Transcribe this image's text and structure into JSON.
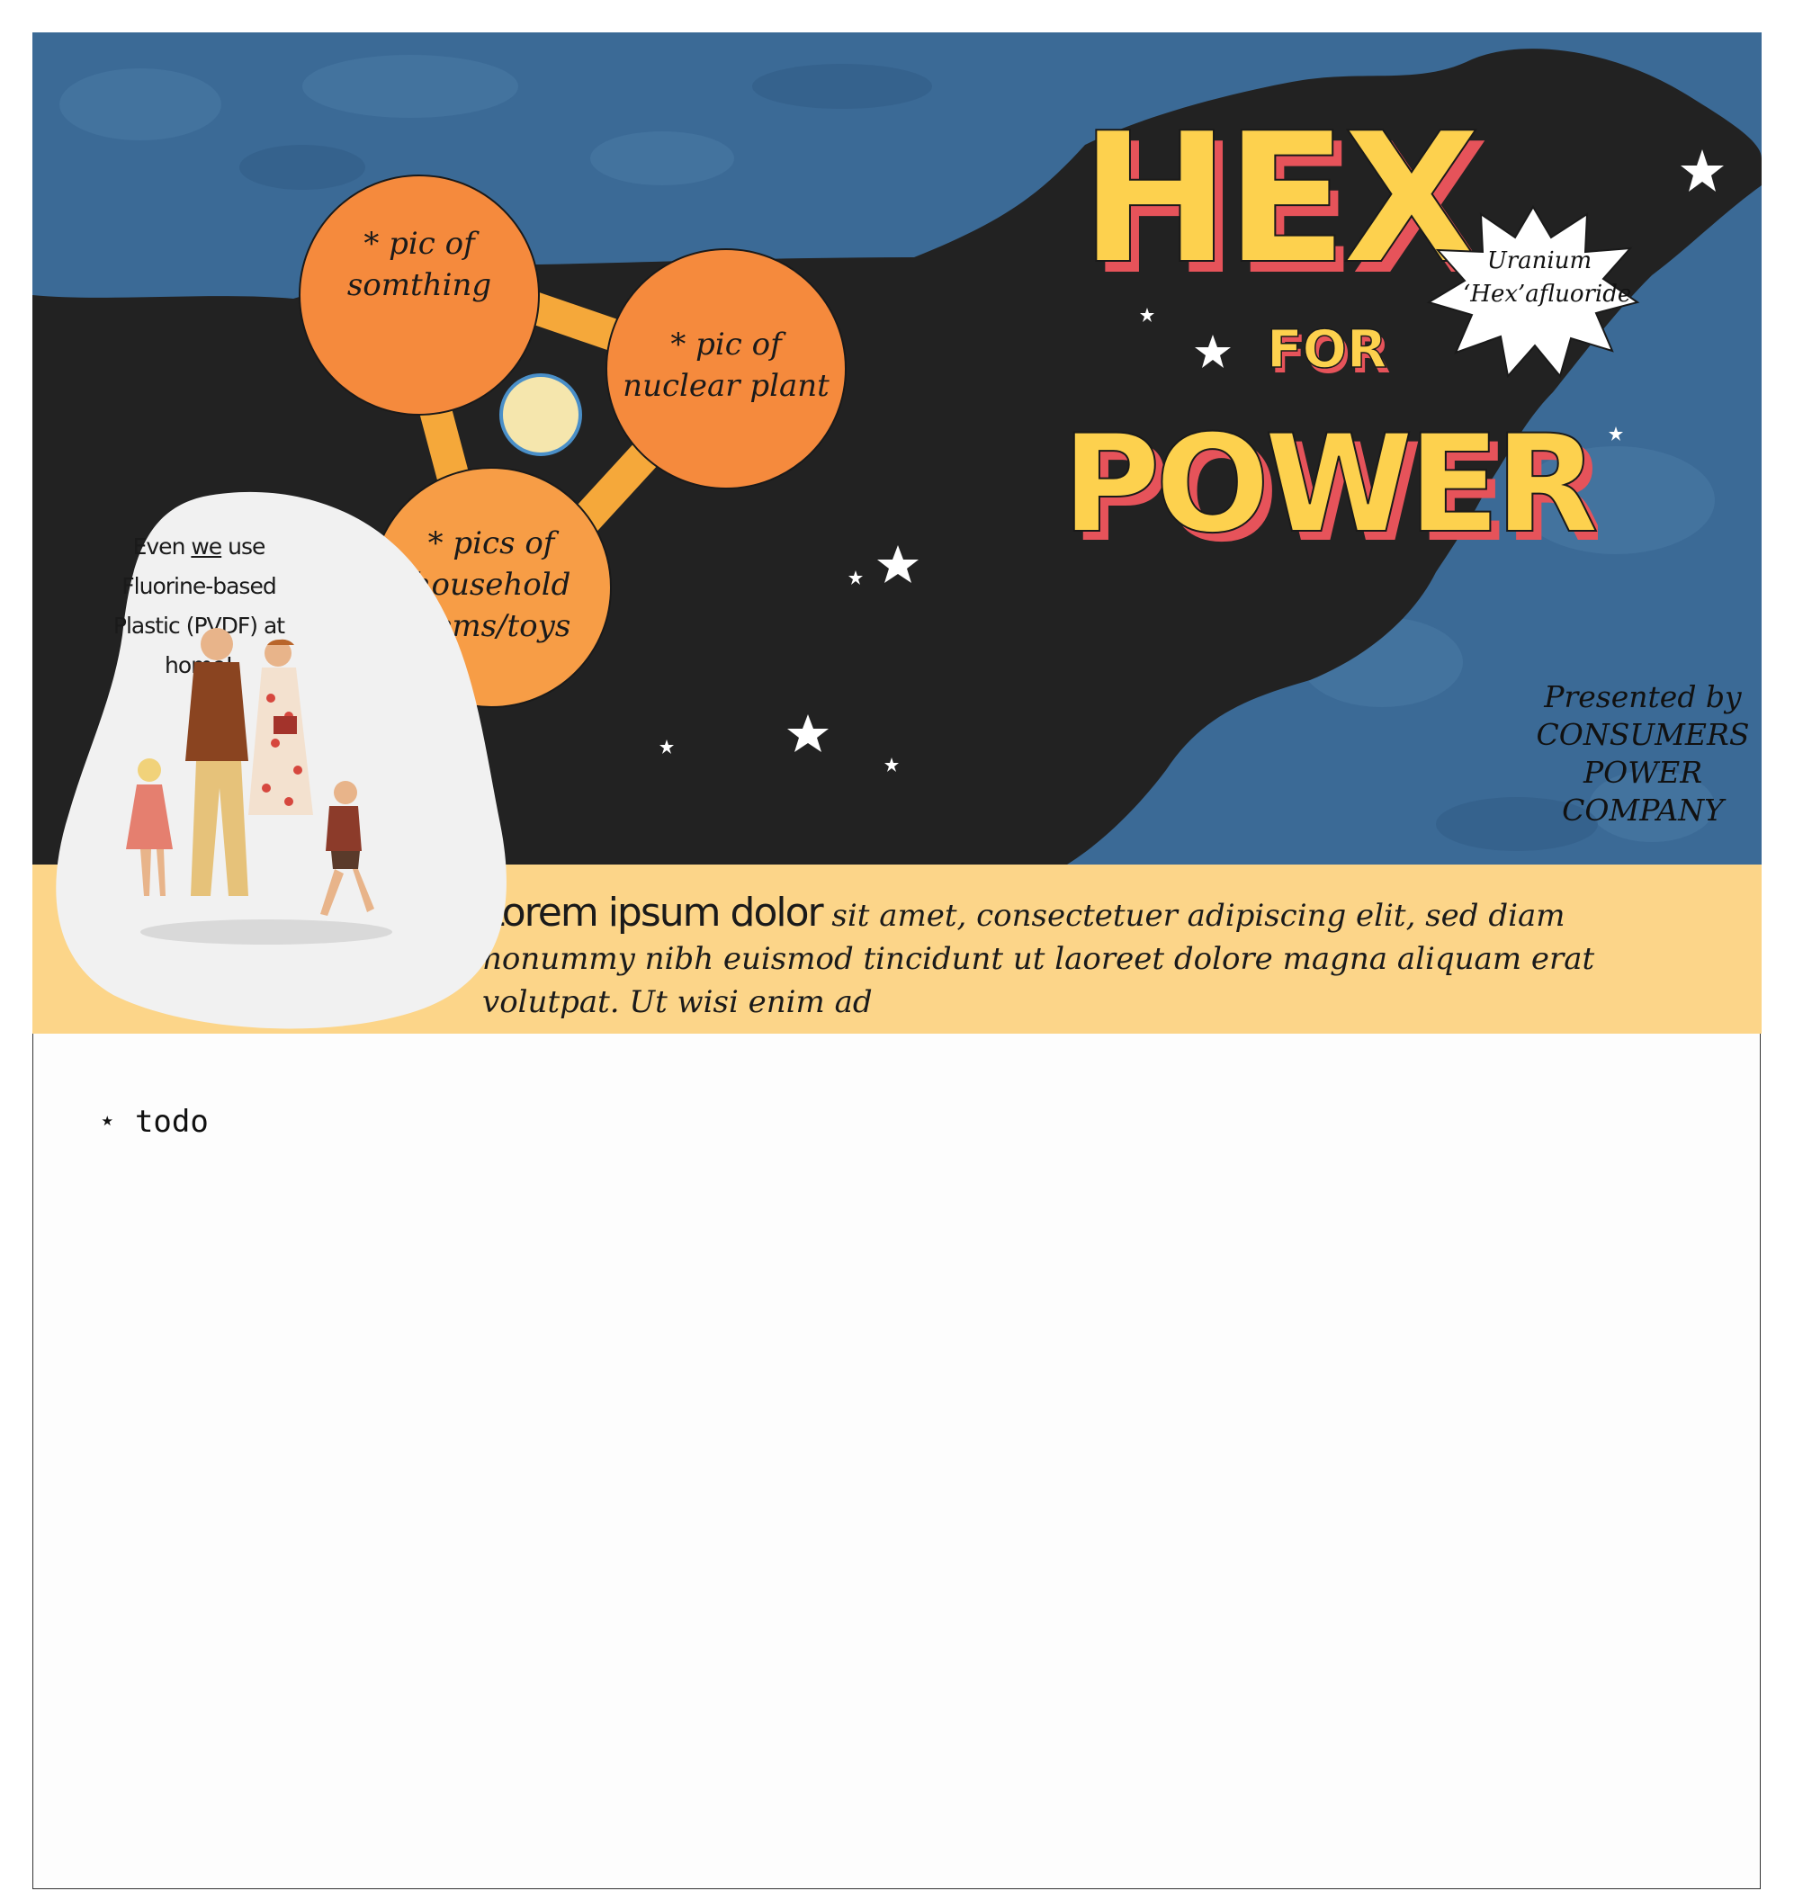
{
  "poster": {
    "title_line1": "HEX",
    "title_line2": "FOR",
    "title_line3": "POWER",
    "burst_line1": "Uranium",
    "burst_line2": "‘Hex’afluoride",
    "presented_by": [
      "Presented by",
      "CONSUMERS",
      "POWER",
      "COMPANY"
    ],
    "circles": [
      {
        "label": "* pic of somthing"
      },
      {
        "label": "* pic of nuclear plant"
      },
      {
        "label": "* pics of household items/toys"
      }
    ],
    "family_caption_pre": "Even ",
    "family_caption_emph": "we",
    "family_caption_post": " use Fluorine-based Plastic (PVDF) at home!",
    "lead_text": "Lorem ipsum dolor",
    "body_text": " sit amet, consectetuer adipiscing elit, sed diam nonummy nibh euismod tincidunt ut laoreet dolore magna aliquam erat volutpat. Ut wisi enim ad",
    "colors": {
      "ocean": "#3b6a96",
      "land": "#222222",
      "circle": "#f58a3d",
      "connector": "#f5a83a",
      "title_face": "#fdd14e",
      "title_side": "#e6535a",
      "band": "#fcd589"
    }
  },
  "content": {
    "todo": "⋆ todo"
  }
}
